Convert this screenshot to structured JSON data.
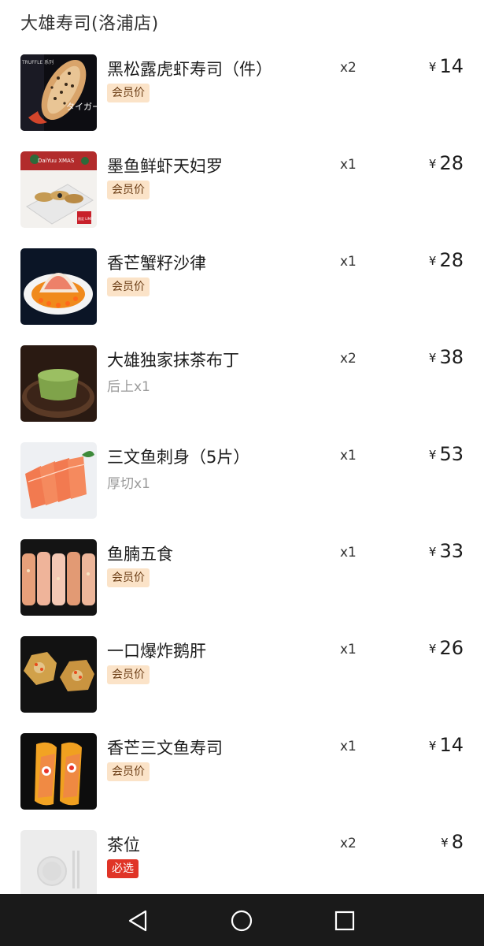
{
  "store": {
    "title": "大雄寿司(洛浦店)"
  },
  "currency_symbol": "¥",
  "items": [
    {
      "name": "黑松露虎虾寿司（件）",
      "qty": "x2",
      "price": "14",
      "tag": "会员价",
      "note": "",
      "image": "truffle-tiger-prawn-sushi-image"
    },
    {
      "name": "墨鱼鲜虾天妇罗",
      "qty": "x1",
      "price": "28",
      "tag": "会员价",
      "note": "",
      "image": "squid-shrimp-tempura-image"
    },
    {
      "name": "香芒蟹籽沙律",
      "qty": "x1",
      "price": "28",
      "tag": "会员价",
      "note": "",
      "image": "mango-crab-roe-salad-image"
    },
    {
      "name": "大雄独家抹茶布丁",
      "qty": "x2",
      "price": "38",
      "tag": "",
      "note": "后上x1",
      "image": "matcha-pudding-image"
    },
    {
      "name": "三文鱼刺身（5片）",
      "qty": "x1",
      "price": "53",
      "tag": "",
      "note": "厚切x1",
      "image": "salmon-sashimi-image"
    },
    {
      "name": "鱼腩五食",
      "qty": "x1",
      "price": "33",
      "tag": "会员价",
      "note": "",
      "image": "fish-belly-five-sushi-image"
    },
    {
      "name": "一口爆炸鹅肝",
      "qty": "x1",
      "price": "26",
      "tag": "会员价",
      "note": "",
      "image": "foie-gras-bites-image"
    },
    {
      "name": "香芒三文鱼寿司",
      "qty": "x1",
      "price": "14",
      "tag": "会员价",
      "note": "",
      "image": "mango-salmon-sushi-image"
    },
    {
      "name": "茶位",
      "qty": "x2",
      "price": "8",
      "tag": "必选",
      "note": "",
      "image": "tea-seat-placeholder-image"
    }
  ],
  "thumb_labels": {
    "item0": "タイガー",
    "item0_side": "TRUFFLE 系列",
    "item1": "DaiYuu XMAS",
    "item1_badge": "限定 LIMIT"
  },
  "navbar": {
    "back": "back-triangle-icon",
    "home": "home-circle-icon",
    "recents": "recents-square-icon"
  },
  "colors": {
    "member_tag_bg": "#fbe3c8",
    "member_tag_text": "#6b3d15",
    "required_tag_bg": "#e03427",
    "navbar_bg": "#1a1a1a"
  }
}
